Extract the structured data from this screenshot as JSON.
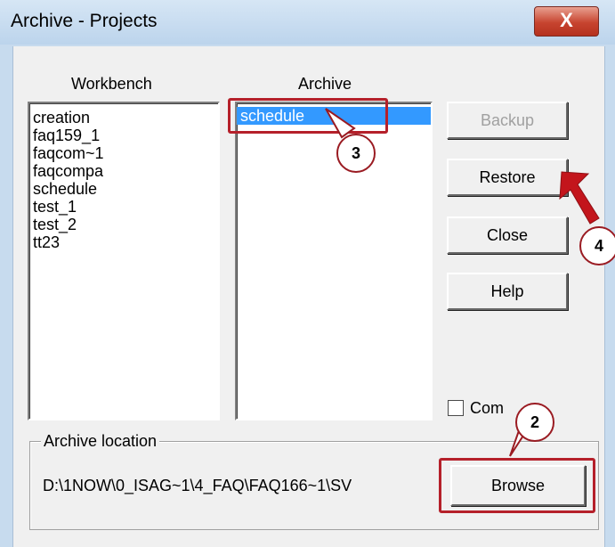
{
  "window": {
    "title": "Archive - Projects",
    "close_glyph": "X"
  },
  "workbench": {
    "header": "Workbench",
    "items": [
      "creation",
      "faq159_1",
      "faqcom~1",
      "faqcompa",
      "schedule",
      "test_1",
      "test_2",
      "tt23"
    ]
  },
  "archive": {
    "header": "Archive",
    "items": [
      "schedule"
    ],
    "selected": "schedule"
  },
  "buttons": {
    "backup": "Backup",
    "restore": "Restore",
    "close": "Close",
    "help": "Help",
    "browse": "Browse"
  },
  "compress": {
    "label": "Com",
    "checked": false
  },
  "archive_location": {
    "label": "Archive location",
    "path": "D:\\1NOW\\0_ISAG~1\\4_FAQ\\FAQ166~1\\SV"
  },
  "annotations": {
    "step2": "2",
    "step3": "3",
    "step4": "4"
  },
  "colors": {
    "annotation_red": "#b5202a",
    "selection_blue": "#3399ff",
    "title_blue": "#c7dbee"
  }
}
